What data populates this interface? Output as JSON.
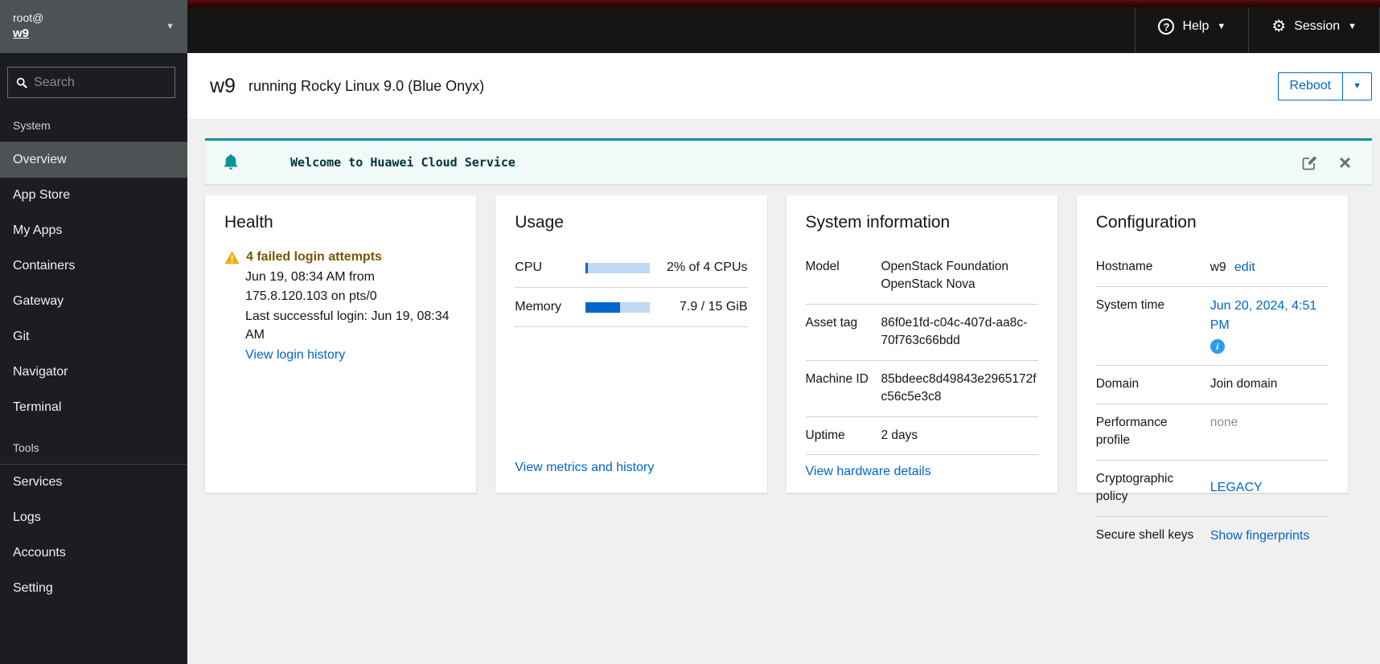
{
  "masthead": {
    "user": {
      "line1": "root@",
      "line2": "w9"
    },
    "help_label": "Help",
    "session_label": "Session"
  },
  "sidebar": {
    "search_placeholder": "Search",
    "sections": [
      {
        "label": "System",
        "items": [
          {
            "label": "Overview",
            "active": true
          },
          {
            "label": "App Store"
          },
          {
            "label": "My Apps"
          },
          {
            "label": "Containers"
          },
          {
            "label": "Gateway"
          },
          {
            "label": "Git"
          },
          {
            "label": "Navigator"
          },
          {
            "label": "Terminal"
          }
        ]
      },
      {
        "label": "Tools",
        "items": [
          {
            "label": "Services"
          },
          {
            "label": "Logs"
          },
          {
            "label": "Accounts"
          },
          {
            "label": "Setting"
          }
        ]
      }
    ]
  },
  "header": {
    "hostname": "w9",
    "subtitle": "running Rocky Linux 9.0 (Blue Onyx)",
    "reboot_label": "Reboot"
  },
  "banner": {
    "message": "Welcome to Huawei Cloud Service"
  },
  "cards": {
    "health": {
      "title": "Health",
      "warning_title": "4 failed login attempts",
      "line1": "Jun 19, 08:34 AM from 175.8.120.103 on pts/0",
      "line2": "Last successful login: Jun 19, 08:34 AM",
      "link": "View login history"
    },
    "usage": {
      "title": "Usage",
      "rows": [
        {
          "label": "CPU",
          "value": "2% of 4 CPUs",
          "percent": 2
        },
        {
          "label": "Memory",
          "value": "7.9 / 15 GiB",
          "percent": 53
        }
      ],
      "link": "View metrics and history"
    },
    "system_info": {
      "title": "System information",
      "rows": [
        {
          "label": "Model",
          "value": "OpenStack Foundation OpenStack Nova"
        },
        {
          "label": "Asset tag",
          "value": "86f0e1fd-c04c-407d-aa8c-70f763c66bdd"
        },
        {
          "label": "Machine ID",
          "value": "85bdeec8d49843e2965172fc56c5e3c8"
        },
        {
          "label": "Uptime",
          "value": "2 days"
        }
      ],
      "link": "View hardware details"
    },
    "configuration": {
      "title": "Configuration",
      "hostname_label": "Hostname",
      "hostname_value": "w9",
      "hostname_edit": "edit",
      "system_time_label": "System time",
      "system_time_value": "Jun 20, 2024, 4:51 PM",
      "domain_label": "Domain",
      "domain_value": "Join domain",
      "perf_label": "Performance profile",
      "perf_value": "none",
      "crypto_label": "Cryptographic policy",
      "crypto_value": "LEGACY",
      "ssh_label": "Secure shell keys",
      "ssh_value": "Show fingerprints"
    }
  },
  "icons": {
    "help": "question-circle",
    "session": "gear",
    "search": "magnifier",
    "banner": "bell",
    "banner_edit": "pencil-square",
    "banner_close": "close-x",
    "health_warning": "warning-triangle",
    "system_time_info": "info-circle",
    "dropdown": "caret-down"
  },
  "colors": {
    "accent_blue": "#0066cc",
    "banner_teal": "#009596",
    "warning_gold": "#f0ab00",
    "warning_text": "#795600",
    "masthead_bg": "#151515",
    "sidebar_bg": "#1b1d21",
    "active_item_bg": "#4f5255",
    "content_bg": "#f0f0f0",
    "masthead_red_strip": "#3a0707"
  }
}
